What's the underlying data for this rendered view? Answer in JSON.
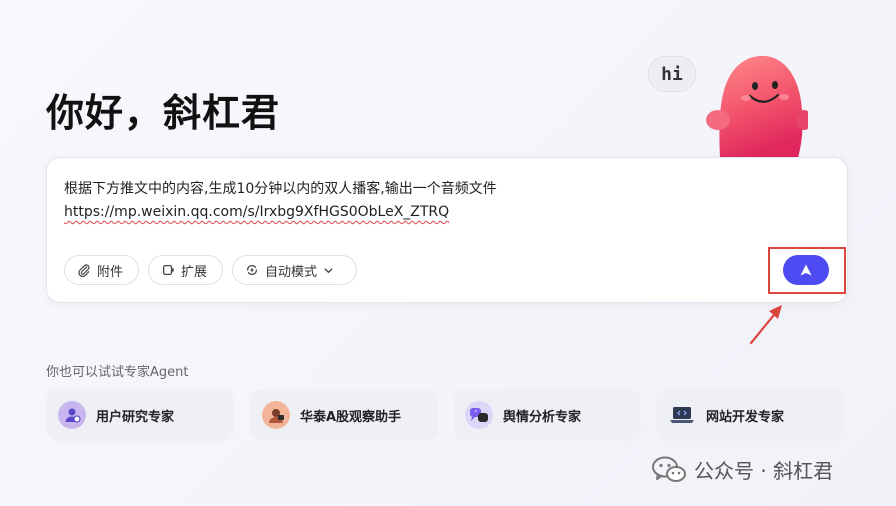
{
  "greeting": "你好，斜杠君",
  "mascot": {
    "bubble_text": "hi"
  },
  "input": {
    "line1": "根据下方推文中的内容,生成10分钟以内的双人播客,输出一个音频文件",
    "line2": "https://mp.weixin.qq.com/s/Irxbg9XfHGS0ObLeX_ZTRQ"
  },
  "toolbar": {
    "attach_label": "附件",
    "expand_label": "扩展",
    "mode_label": "自动模式"
  },
  "experts": {
    "title": "你也可以试试专家Agent",
    "items": [
      {
        "label": "用户研究专家",
        "icon": "user-research-icon"
      },
      {
        "label": "华泰A股观察助手",
        "icon": "stock-analyst-icon"
      },
      {
        "label": "舆情分析专家",
        "icon": "sentiment-icon"
      },
      {
        "label": "网站开发专家",
        "icon": "laptop-code-icon"
      }
    ]
  },
  "watermark": "公众号 · 斜杠君",
  "colors": {
    "accent": "#4f4bf2",
    "highlight": "#d9473c",
    "mascot": "#f2506a"
  }
}
